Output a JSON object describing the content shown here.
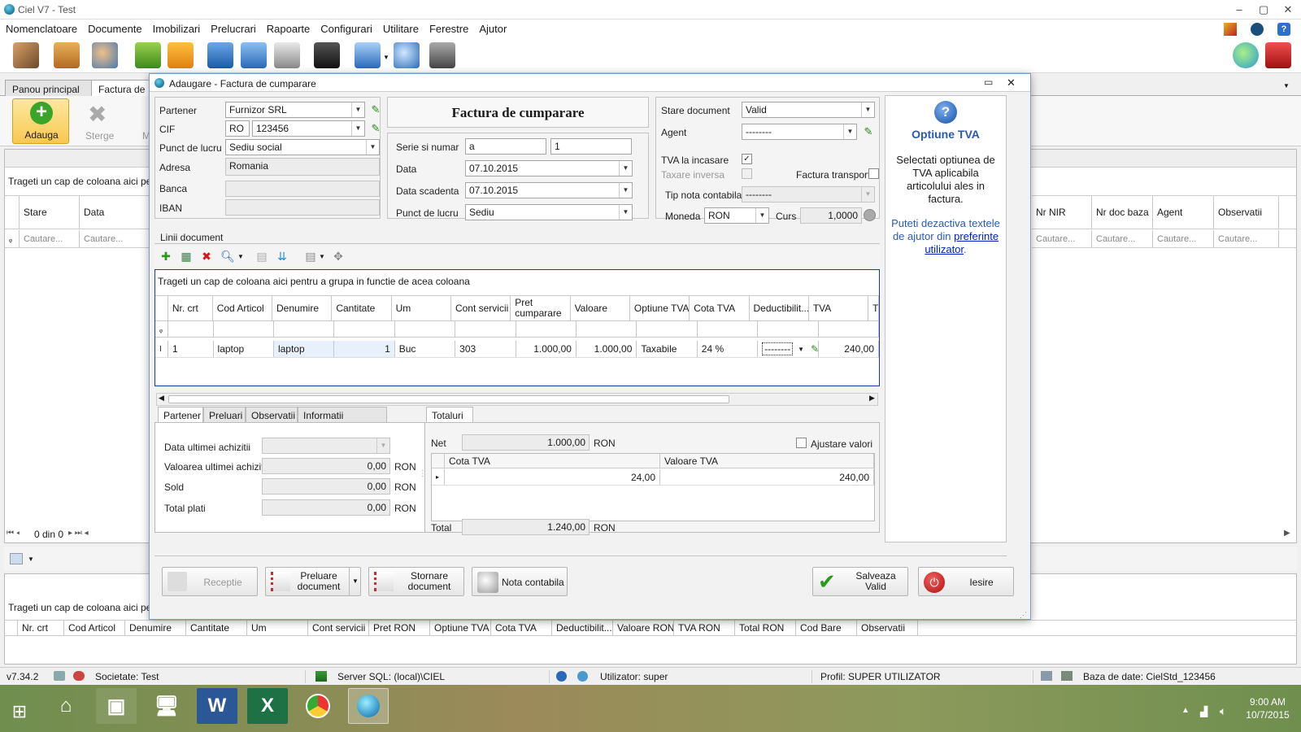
{
  "window": {
    "title": "Ciel V7 - Test",
    "controls": [
      "–",
      "▢",
      "✕"
    ]
  },
  "menu": [
    "Nomenclatoare",
    "Documente",
    "Imobilizari",
    "Prelucrari",
    "Rapoarte",
    "Configurari",
    "Utilitare",
    "Ferestre",
    "Ajutor"
  ],
  "main_tabs": {
    "panou": "Panou principal",
    "factura": "Factura de c"
  },
  "ribbon": {
    "adauga": "Adauga",
    "sterge": "Sterge",
    "m": "M"
  },
  "background_grid": {
    "group_hint": "Trageti un cap de coloana aici pentr",
    "cols_left": [
      "Stare",
      "Data"
    ],
    "filter": "Cautare...",
    "cols_right": [
      "Nr NIR",
      "Nr doc baza",
      "Agent",
      "Observatii"
    ],
    "pager": "0 din 0",
    "lower_hint": "Trageti un cap de coloana aici pentr",
    "lower_cols": [
      "Nr. crt",
      "Cod Articol",
      "Denumire",
      "Cantitate",
      "Um",
      "Cont servicii",
      "Pret RON",
      "Optiune TVA",
      "Cota TVA",
      "Deductibilit...",
      "Valoare RON",
      "TVA RON",
      "Total RON",
      "Cod Bare",
      "Observatii"
    ]
  },
  "dialog": {
    "title": "Adaugare - Factura de cumparare",
    "heading": "Factura de cumparare",
    "partner": {
      "partener_label": "Partener",
      "partener": "Furnizor SRL",
      "cif_label": "CIF",
      "cif_prefix": "RO",
      "cif": "123456",
      "punct_label": "Punct de lucru",
      "punct": "Sediu social",
      "adresa_label": "Adresa",
      "adresa": "Romania",
      "banca_label": "Banca",
      "banca": "",
      "iban_label": "IBAN",
      "iban": ""
    },
    "doc": {
      "serie_label": "Serie si numar",
      "serie": "a",
      "numar": "1",
      "data_label": "Data",
      "data": "07.10.2015",
      "scad_label": "Data scadenta",
      "scadenta": "07.10.2015",
      "punct_label": "Punct de lucru",
      "punct": "Sediu"
    },
    "status": {
      "stare_label": "Stare document",
      "stare": "Valid",
      "agent_label": "Agent",
      "agent": "--------",
      "tva_inc_label": "TVA la incasare",
      "tva_inc": "✓",
      "taxare_label": "Taxare inversa",
      "transport_label": "Factura transport",
      "nota_label": "Tip nota contabila",
      "nota": "--------",
      "moneda_label": "Moneda",
      "moneda": "RON",
      "curs_label": "Curs",
      "curs": "1,0000"
    },
    "lines": {
      "title": "Linii document",
      "group_hint": "Trageti un cap de coloana aici pentru a grupa in functie de acea coloana",
      "columns": [
        "Nr. crt",
        "Cod Articol",
        "Denumire",
        "Cantitate",
        "Um",
        "Cont servicii",
        "Pret cumparare",
        "Valoare",
        "Optiune TVA",
        "Cota TVA",
        "Deductibilit...",
        "TVA",
        "T"
      ],
      "row": {
        "nr": "1",
        "cod": "laptop",
        "den": "laptop",
        "cant": "1",
        "um": "Buc",
        "cont": "303",
        "pret": "1.000,00",
        "valoare": "1.000,00",
        "optiune": "Taxabile",
        "cota": "24 %",
        "deduct": "--------",
        "tva": "240,00"
      }
    },
    "bottom_tabs": [
      "Partener",
      "Preluari",
      "Observatii",
      "Informatii aditionale"
    ],
    "partner_info": {
      "data_ult_label": "Data ultimei achizitii",
      "val_ult_label": "Valoarea ultimei achizitii",
      "val_ult": "0,00",
      "sold_label": "Sold",
      "sold": "0,00",
      "plati_label": "Total plati",
      "plati": "0,00",
      "currency": "RON"
    },
    "totals": {
      "tab": "Totaluri",
      "net_label": "Net",
      "net": "1.000,00",
      "currency": "RON",
      "ajustare": "Ajustare valori",
      "col_cota": "Cota TVA",
      "col_valoare": "Valoare TVA",
      "cota": "24,00",
      "valoare": "240,00",
      "total_label": "Total",
      "total": "1.240,00"
    },
    "help": {
      "title": "Optiune TVA",
      "text": "Selectati optiunea de TVA aplicabila articolului ales in factura.",
      "text2": "Puteti dezactiva textele de ajutor din",
      "link": "preferinte utilizator",
      "dot": "."
    },
    "buttons": {
      "receptie": "Receptie",
      "preluare": "Preluare document",
      "stornare": "Stornare document",
      "nota": "Nota contabila",
      "salveaza": "Salveaza Valid",
      "iesire": "Iesire"
    }
  },
  "statusbar": {
    "version": "v7.34.2",
    "societate": "Societate: Test",
    "server": "Server SQL: (local)\\CIEL",
    "utilizator": "Utilizator: super",
    "profil": "Profil: SUPER UTILIZATOR",
    "baza": "Baza de date: CielStd_123456"
  },
  "taskbar": {
    "time": "9:00 AM",
    "date": "10/7/2015"
  }
}
